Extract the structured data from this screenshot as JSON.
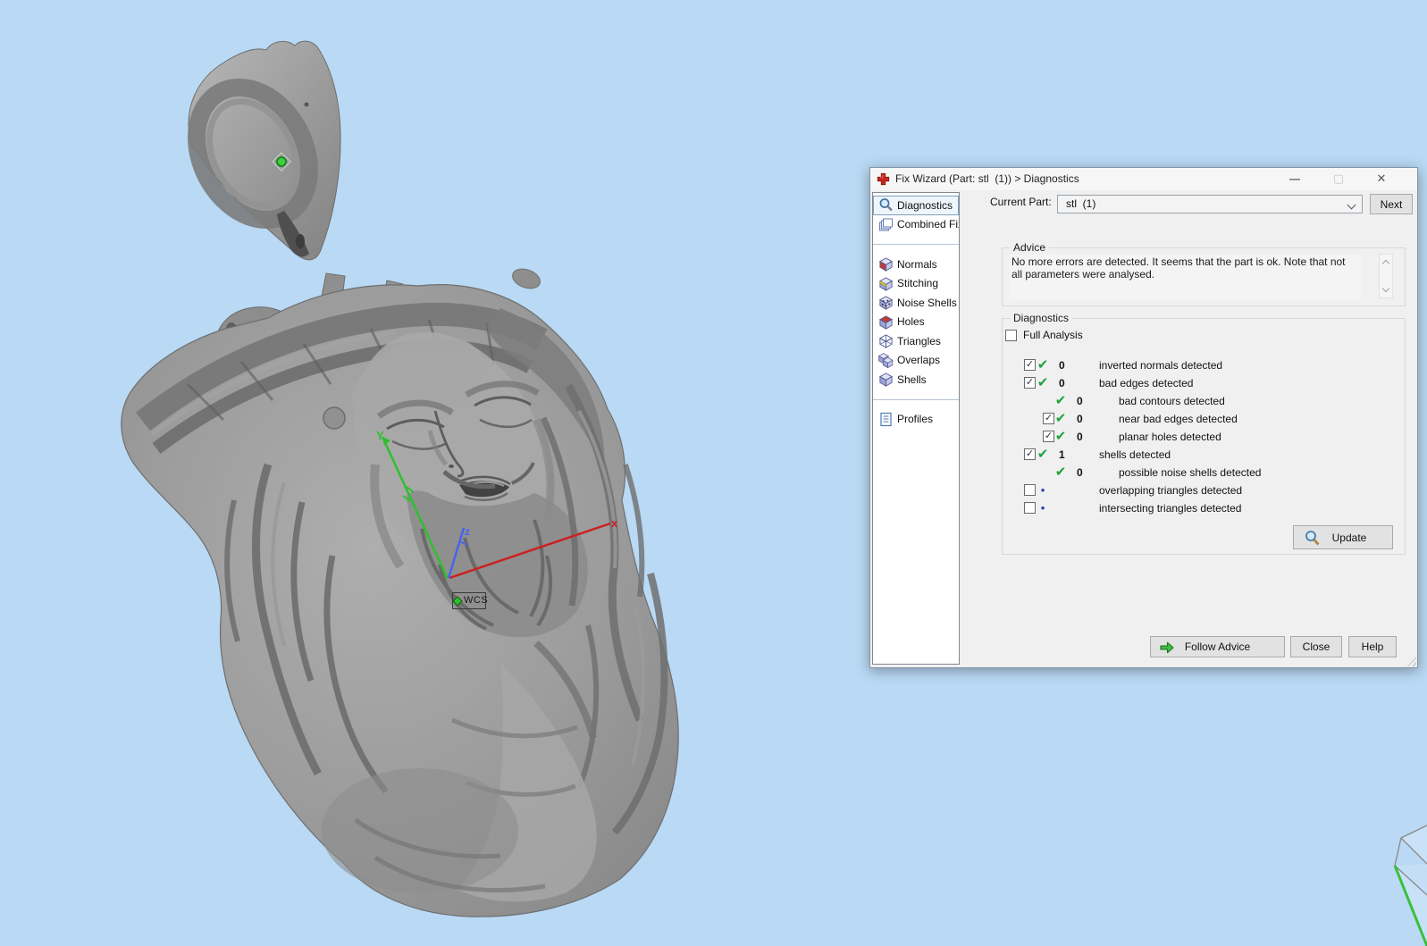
{
  "colors": {
    "viewport_bg": "#b9d9f4",
    "check_green": "#1da33c",
    "dot_blue": "#2a35a8",
    "axis_x_red": "#cc2020",
    "axis_y_green": "#2fbf2f",
    "axis_z_blue": "#4a63e8",
    "model_gray": "#9a9a9a"
  },
  "viewport": {
    "model_description": "gray sculpture of a head with crown of thorns (pendant) plus separate bail piece",
    "wcs_label": "WCS",
    "axis_labels": {
      "x": "x",
      "y": "Y",
      "z": "z"
    }
  },
  "dialog": {
    "title": "Fix Wizard (Part: stl  (1)) > Diagnostics",
    "titlebar_icon": "red-cross",
    "window_buttons": {
      "minimize": "—",
      "maximize": "▢",
      "close": "✕"
    },
    "sidebar": {
      "groups": [
        {
          "items": [
            {
              "label": "Diagnostics",
              "icon": "magnifier",
              "selected": true
            },
            {
              "label": "Combined Fix",
              "icon": "stack"
            }
          ]
        },
        {
          "items": [
            {
              "label": "Normals",
              "icon": "cube-red-face"
            },
            {
              "label": "Stitching",
              "icon": "cube-yellow-edge"
            },
            {
              "label": "Noise Shells",
              "icon": "cube-dots"
            },
            {
              "label": "Holes",
              "icon": "cube-red-top"
            },
            {
              "label": "Triangles",
              "icon": "cube-wireframe"
            },
            {
              "label": "Overlaps",
              "icon": "cube-overlap"
            },
            {
              "label": "Shells",
              "icon": "cube-plain"
            }
          ]
        },
        {
          "items": [
            {
              "label": "Profiles",
              "icon": "document"
            }
          ]
        }
      ]
    },
    "current_part": {
      "label": "Current Part:",
      "value": "stl  (1)",
      "next_button": "Next"
    },
    "advice": {
      "title": "Advice",
      "text": "No more errors are detected. It seems that the part is ok. Note that not all parameters were analysed."
    },
    "diagnostics": {
      "title": "Diagnostics",
      "full_analysis_label": "Full Analysis",
      "full_analysis_checked": false,
      "rows": [
        {
          "indent": 0,
          "checkbox": "checked",
          "status": "check",
          "count": "0",
          "label": "inverted normals detected"
        },
        {
          "indent": 0,
          "checkbox": "checked",
          "status": "check",
          "count": "0",
          "label": "bad edges detected"
        },
        {
          "indent": 1,
          "checkbox": "none",
          "status": "check",
          "count": "0",
          "label": "bad contours detected"
        },
        {
          "indent": 1,
          "checkbox": "checked",
          "status": "check",
          "count": "0",
          "label": "near bad edges detected"
        },
        {
          "indent": 1,
          "checkbox": "checked",
          "status": "check",
          "count": "0",
          "label": "planar holes detected"
        },
        {
          "indent": 0,
          "checkbox": "checked",
          "status": "check",
          "count": "1",
          "label": "shells detected"
        },
        {
          "indent": 1,
          "checkbox": "none",
          "status": "check",
          "count": "0",
          "label": "possible noise shells detected"
        },
        {
          "indent": 0,
          "checkbox": "unchecked",
          "status": "dot",
          "count": "",
          "label": "overlapping triangles detected"
        },
        {
          "indent": 0,
          "checkbox": "unchecked",
          "status": "dot",
          "count": "",
          "label": "intersecting triangles detected"
        }
      ],
      "update_button": "Update"
    },
    "footer": {
      "follow_advice": "Follow Advice",
      "close": "Close",
      "help": "Help"
    }
  },
  "icons": {
    "titlebar": "red-cross",
    "sidebar_diagnostics": "magnifier",
    "sidebar_combined_fix": "stacked-sheets",
    "sidebar_mesh_items": "cube-variants",
    "sidebar_profiles": "document",
    "update": "magnifier",
    "follow_advice": "green-arrow-right",
    "current_part_dropdown": "chevron-down",
    "advice_scrollbar": "chevron-up-down"
  }
}
